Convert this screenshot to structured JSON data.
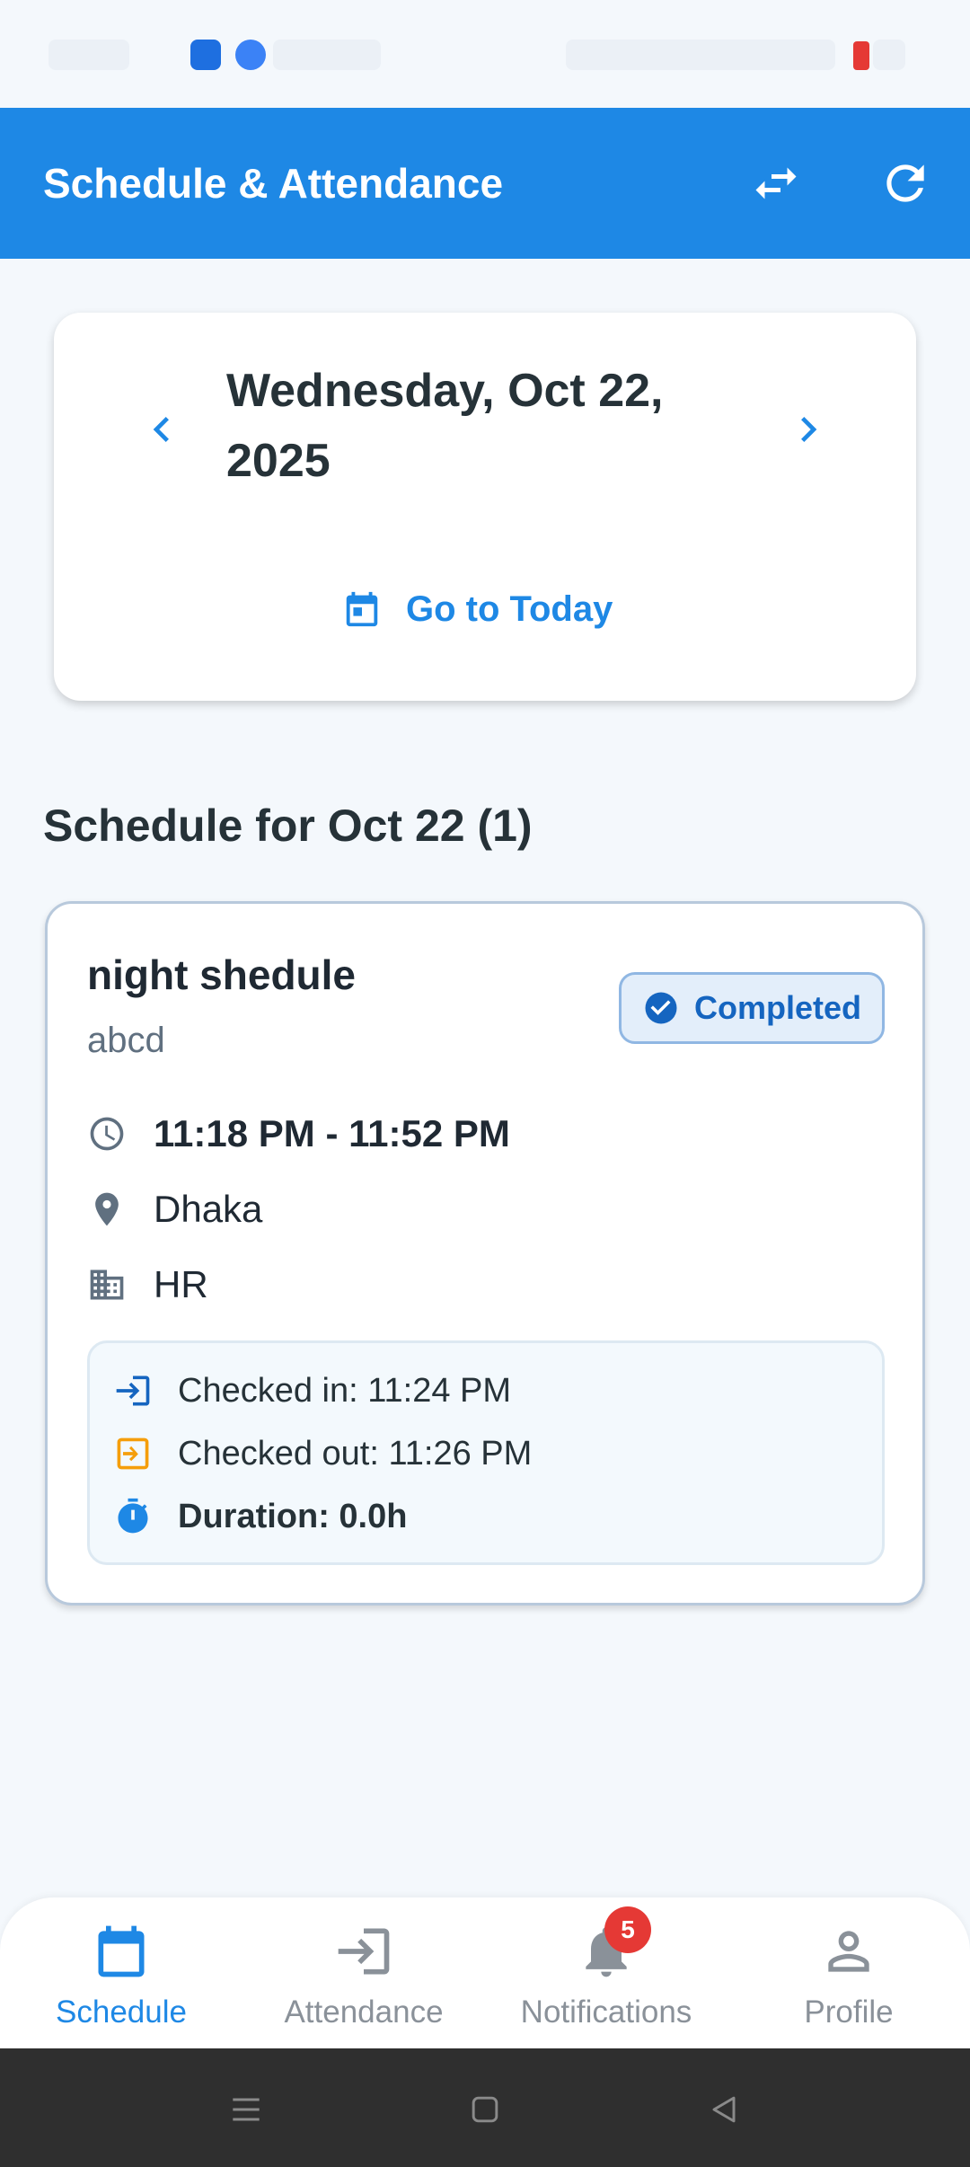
{
  "app_bar": {
    "title": "Schedule & Attendance",
    "swap_icon": "swap-horiz-icon",
    "refresh_icon": "refresh-icon"
  },
  "date_card": {
    "date_text": "Wednesday, Oct 22, 2025",
    "today_label": "Go to Today"
  },
  "section": {
    "title": "Schedule for Oct 22 (1)"
  },
  "schedule": {
    "name": "night shedule",
    "description": "abcd",
    "status": "Completed",
    "time": "11:18 PM - 11:52 PM",
    "location": "Dhaka",
    "department": "HR",
    "checked_in": "Checked in: 11:24 PM",
    "checked_out": "Checked out: 11:26 PM",
    "duration": "Duration: 0.0h"
  },
  "bottom_nav": {
    "items": [
      {
        "label": "Schedule",
        "icon": "calendar-icon",
        "active": true
      },
      {
        "label": "Attendance",
        "icon": "login-icon",
        "active": false
      },
      {
        "label": "Notifications",
        "icon": "bell-icon",
        "active": false,
        "badge": "5"
      },
      {
        "label": "Profile",
        "icon": "person-icon",
        "active": false
      }
    ]
  },
  "colors": {
    "primary": "#1e88e5",
    "background": "#f4f8fc",
    "badge_red": "#e53935",
    "checkout_orange": "#f59e0b"
  }
}
